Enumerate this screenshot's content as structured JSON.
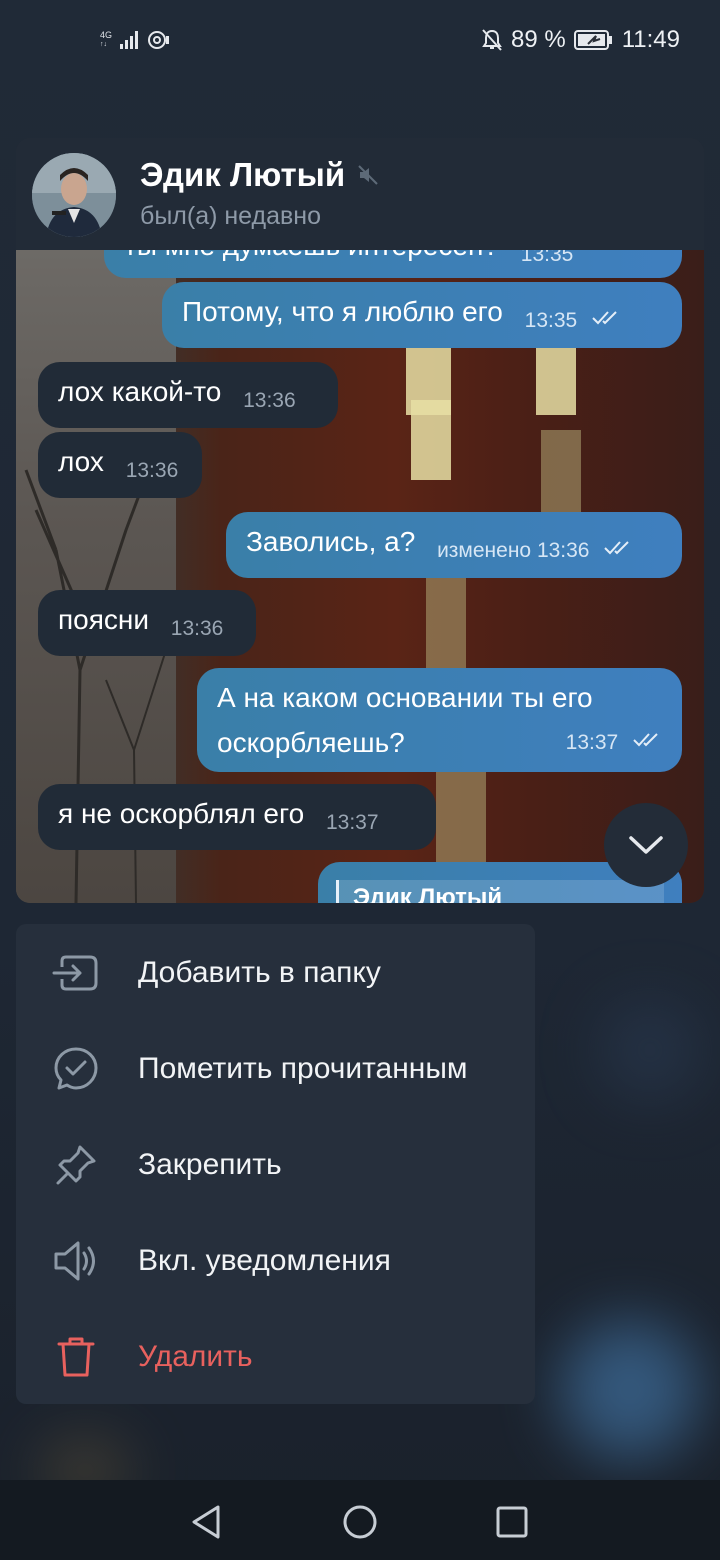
{
  "status_bar": {
    "network": "4G",
    "battery_percent": "89 %",
    "clock": "11:49"
  },
  "chat": {
    "name": "Эдик Лютый",
    "status": "был(а) недавно",
    "partial_top_text": "ты мне думаешь интересен?",
    "partial_top_time": "13:35",
    "messages": [
      {
        "dir": "out",
        "text": "Потому, что я люблю его",
        "time": "13:35"
      },
      {
        "dir": "in",
        "text": "лох какой-то",
        "time": "13:36"
      },
      {
        "dir": "in",
        "text": "лох",
        "time": "13:36"
      },
      {
        "dir": "out",
        "text": "Заволись, а?",
        "edited": "изменено",
        "time": "13:36"
      },
      {
        "dir": "in",
        "text": "поясни",
        "time": "13:36"
      },
      {
        "dir": "out",
        "text_line1": "А на каком основании ты его",
        "text_line2": "оскорбляешь?",
        "time": "13:37"
      },
      {
        "dir": "in",
        "text": "я не оскорблял его",
        "time": "13:37"
      }
    ],
    "partial_reply_name": "Эдик Лютый"
  },
  "menu": {
    "items": [
      {
        "label": "Добавить в папку",
        "icon": "add-to-folder-icon"
      },
      {
        "label": "Пометить прочитанным",
        "icon": "mark-read-icon"
      },
      {
        "label": "Закрепить",
        "icon": "pin-icon"
      },
      {
        "label": "Вкл. уведомления",
        "icon": "speaker-icon"
      },
      {
        "label": "Удалить",
        "icon": "trash-icon"
      }
    ]
  },
  "colors": {
    "accent_outgoing": "#3f7fbf",
    "danger": "#e8615e",
    "menu_bg": "#262f3c"
  }
}
